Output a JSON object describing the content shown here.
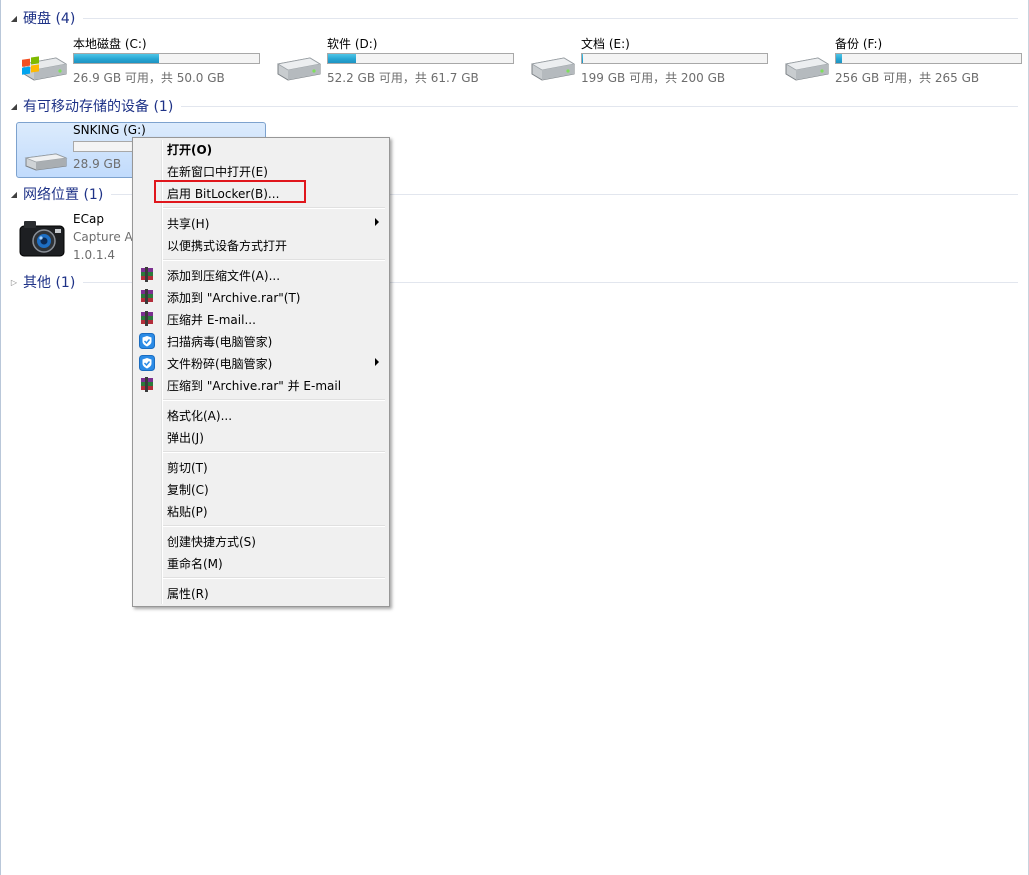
{
  "groups": {
    "hard_disks": {
      "title": "硬盘 (4)"
    },
    "removable": {
      "title": "有可移动存储的设备 (1)"
    },
    "network": {
      "title": "网络位置 (1)"
    },
    "other": {
      "title": "其他 (1)"
    }
  },
  "drives": [
    {
      "name": "本地磁盘 (C:)",
      "free_text": "26.9 GB 可用，共 50.0 GB",
      "used_fraction": 0.462,
      "icon": "windows-drive-icon"
    },
    {
      "name": "软件 (D:)",
      "free_text": "52.2 GB 可用，共 61.7 GB",
      "used_fraction": 0.154,
      "icon": "hard-drive-icon"
    },
    {
      "name": "文档 (E:)",
      "free_text": "199 GB 可用，共 200 GB",
      "used_fraction": 0.005,
      "icon": "hard-drive-icon"
    },
    {
      "name": "备份 (F:)",
      "free_text": "256 GB 可用，共 265 GB",
      "used_fraction": 0.034,
      "icon": "hard-drive-icon"
    }
  ],
  "removable": {
    "name": "SNKING (G:)",
    "free_text": "28.9 GB",
    "used_fraction": 0.0,
    "icon": "usb-drive-icon"
  },
  "network_location": {
    "name": "ECap",
    "line2": "Capture A",
    "line3": "1.0.1.4",
    "icon": "camera-icon"
  },
  "context_menu": {
    "items": [
      {
        "label": "打开(O)",
        "bold": true
      },
      {
        "label": "在新窗口中打开(E)"
      },
      {
        "label": "启用 BitLocker(B)...",
        "highlighted": true
      },
      {
        "label": "共享(H)",
        "submenu": true
      },
      {
        "label": "以便携式设备方式打开"
      },
      {
        "label": "添加到压缩文件(A)...",
        "icon": "winrar-icon"
      },
      {
        "label": "添加到 \"Archive.rar\"(T)",
        "icon": "winrar-icon"
      },
      {
        "label": "压缩并 E-mail...",
        "icon": "winrar-icon"
      },
      {
        "label": "扫描病毒(电脑管家)",
        "icon": "shield-icon"
      },
      {
        "label": "文件粉碎(电脑管家)",
        "icon": "shield-icon",
        "submenu": true
      },
      {
        "label": "压缩到 \"Archive.rar\" 并 E-mail",
        "icon": "winrar-icon"
      },
      {
        "label": "格式化(A)..."
      },
      {
        "label": "弹出(J)"
      },
      {
        "label": "剪切(T)"
      },
      {
        "label": "复制(C)"
      },
      {
        "label": "粘贴(P)"
      },
      {
        "label": "创建快捷方式(S)"
      },
      {
        "label": "重命名(M)"
      },
      {
        "label": "属性(R)"
      }
    ]
  },
  "colors": {
    "group_title": "#1e3287",
    "bar_fill": "#27a6d3",
    "highlight_box": "#e0161c",
    "selection": "#c1dbfc"
  }
}
